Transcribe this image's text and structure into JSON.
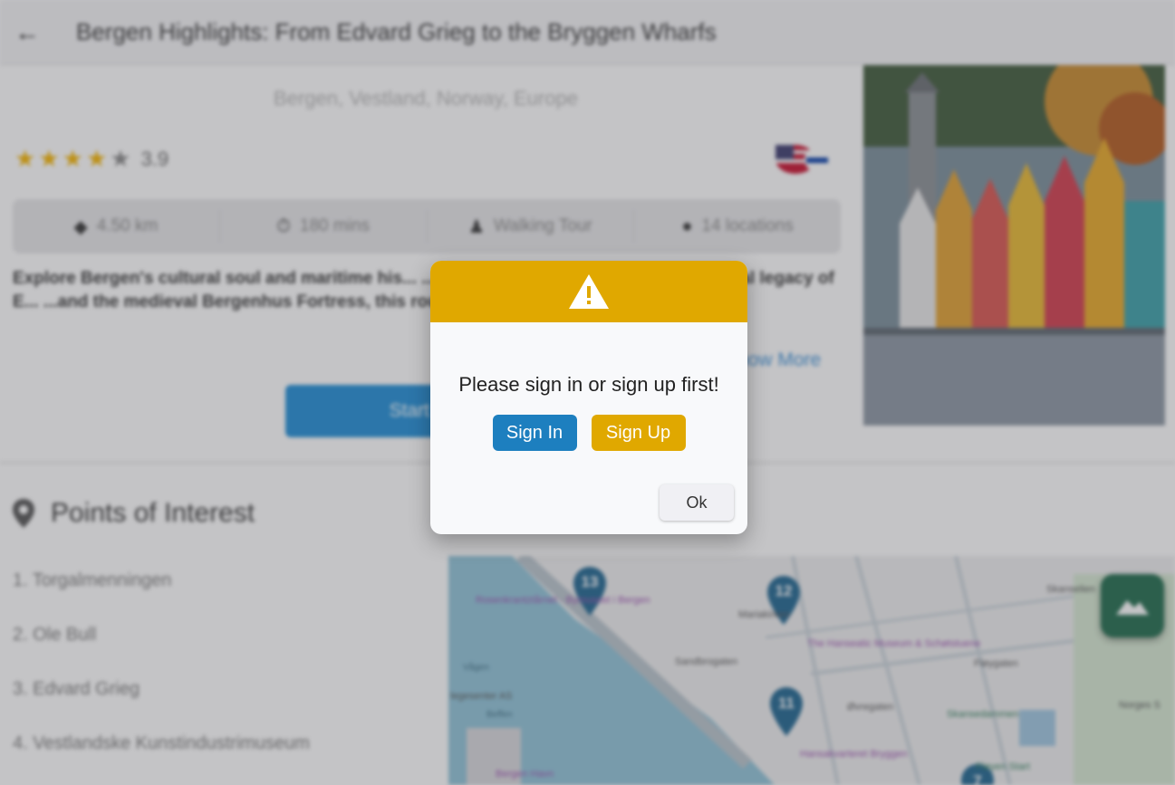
{
  "header": {
    "back_icon": "arrow-left-icon",
    "title": "Bergen Highlights: From Edvard Grieg to the Bryggen Wharfs"
  },
  "tour": {
    "location": "Bergen, Vestland, Norway, Europe",
    "rating": 3.9,
    "rating_label": "3.9",
    "language_icon": "us-flag-icon",
    "stats": [
      {
        "icon": "route-icon",
        "label": "4.50 km"
      },
      {
        "icon": "timer-icon",
        "label": "180 mins"
      },
      {
        "icon": "walking-icon",
        "label": "Walking Tour"
      },
      {
        "icon": "pin-icon",
        "label": "14 locations"
      }
    ],
    "description": "Explore Bergen's cultural soul and maritime his... ...ting Torgallmenningen and the musical legacy of E... ...and the medieval Bergenhus Fortress, this route unvei... ...spirit, a...",
    "show_more": "Show More",
    "start_button": "Start Tour"
  },
  "poi": {
    "title": "Points of Interest",
    "items": [
      "1. Torgalmenningen",
      "2. Ole Bull",
      "3. Edvard Grieg",
      "4. Vestlandske Kunstindustrimuseum"
    ]
  },
  "map": {
    "markers": [
      "13",
      "12",
      "11",
      "7"
    ],
    "labels": [
      "Rosenkrantztårnet - Bymuseet i Bergen",
      "Mariakirken",
      "The Hanseatic Museum & Schøtstuene",
      "Vågen",
      "legesenter AS",
      "Beffen",
      "Hansakvarteret Bryggen",
      "Bergen Havn",
      "Skansedammen",
      "Fløyen Start",
      "Norges S",
      "Fløygaten",
      "Øvregaten",
      "Sandbrogaten",
      "Skanselien"
    ],
    "layers_button_icon": "mountain-icon"
  },
  "dialog": {
    "icon": "warning-icon",
    "message": "Please sign in or sign up first!",
    "sign_in": "Sign In",
    "sign_up": "Sign Up",
    "ok": "Ok"
  },
  "colors": {
    "warning": "#e0a800",
    "primary": "#1d7fbf"
  }
}
